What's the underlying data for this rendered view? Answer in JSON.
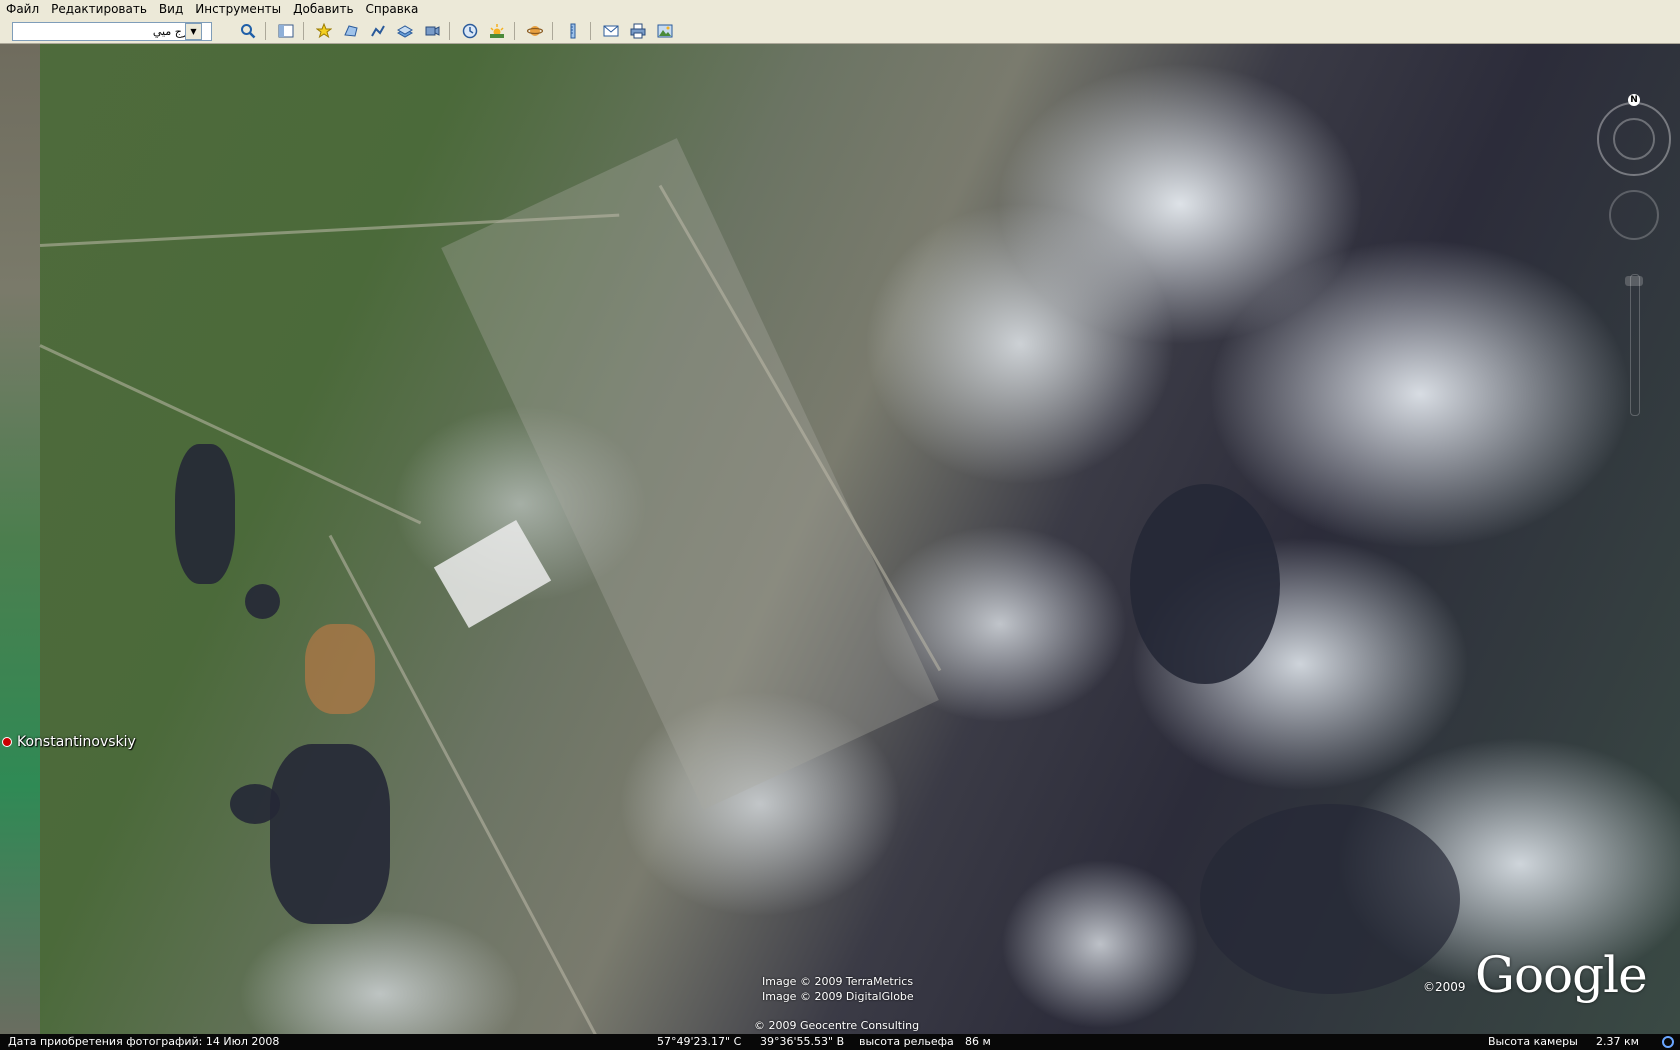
{
  "menu": {
    "items": [
      "Файл",
      "Редактировать",
      "Вид",
      "Инструменты",
      "Добавить",
      "Справка"
    ]
  },
  "toolbar": {
    "search_value": "برج ميي",
    "icons": [
      "hide-sidebar-icon",
      "placemark-icon",
      "polygon-icon",
      "path-icon",
      "image-overlay-icon",
      "record-tour-icon",
      "historical-imagery-icon",
      "sunlight-icon",
      "planets-icon",
      "ruler-icon",
      "email-icon",
      "print-icon",
      "save-image-icon"
    ]
  },
  "map": {
    "place_label": "Konstantinovskiy",
    "compass_label": "N",
    "credit_1": "Image © 2009 TerraMetrics",
    "credit_2": "Image © 2009 DigitalGlobe",
    "credit_3": "© 2009 Geocentre Consulting",
    "copyright": "©2009",
    "logo": "Google"
  },
  "status": {
    "imagery_date": "Дата приобретения фотографий: 14 Июл 2008",
    "latitude": "57°49'23.17\" С",
    "longitude": "39°36'55.53\" В",
    "elevation_label": "высота рельефа",
    "elevation_value": "86 м",
    "eye_alt_label": "Высота камеры",
    "eye_alt_value": "2.37 км"
  },
  "colors": {
    "chrome": "#ece9d8",
    "place_dot": "#cc0000"
  }
}
